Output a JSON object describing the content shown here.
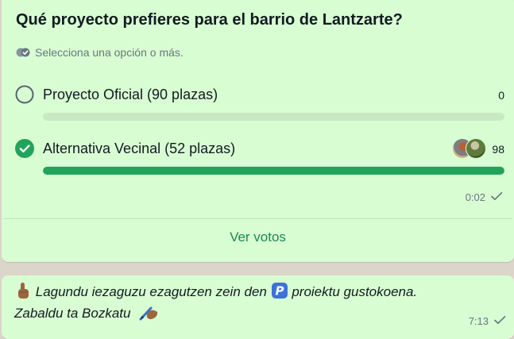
{
  "poll": {
    "title": "Qué proyecto prefieres para el barrio de Lantzarte?",
    "subtitle": "Selecciona una opción o más.",
    "options": [
      {
        "label": "Proyecto Oficial (90 plazas)",
        "votes": "0",
        "selected": false,
        "fraction": 0
      },
      {
        "label": "Alternativa Vecinal (52 plazas)",
        "votes": "98",
        "selected": true,
        "fraction": 1.0
      }
    ],
    "time": "0:02",
    "view_votes_label": "Ver votos"
  },
  "message": {
    "line1_a": "Lagundu iezaguzu ezagutzen zein den",
    "line1_b": "proiektu gustokoena.",
    "line2": "Zabaldu ta Bozkatu",
    "time": "7:13",
    "emojis": [
      "index-finger-up-emoji",
      "p-button-emoji",
      "writing-hand-emoji"
    ]
  },
  "colors": {
    "bubble": "#d9fdd3",
    "accent": "#21a35c",
    "bar_track": "#c9e8c4",
    "link": "#1a8a52"
  }
}
